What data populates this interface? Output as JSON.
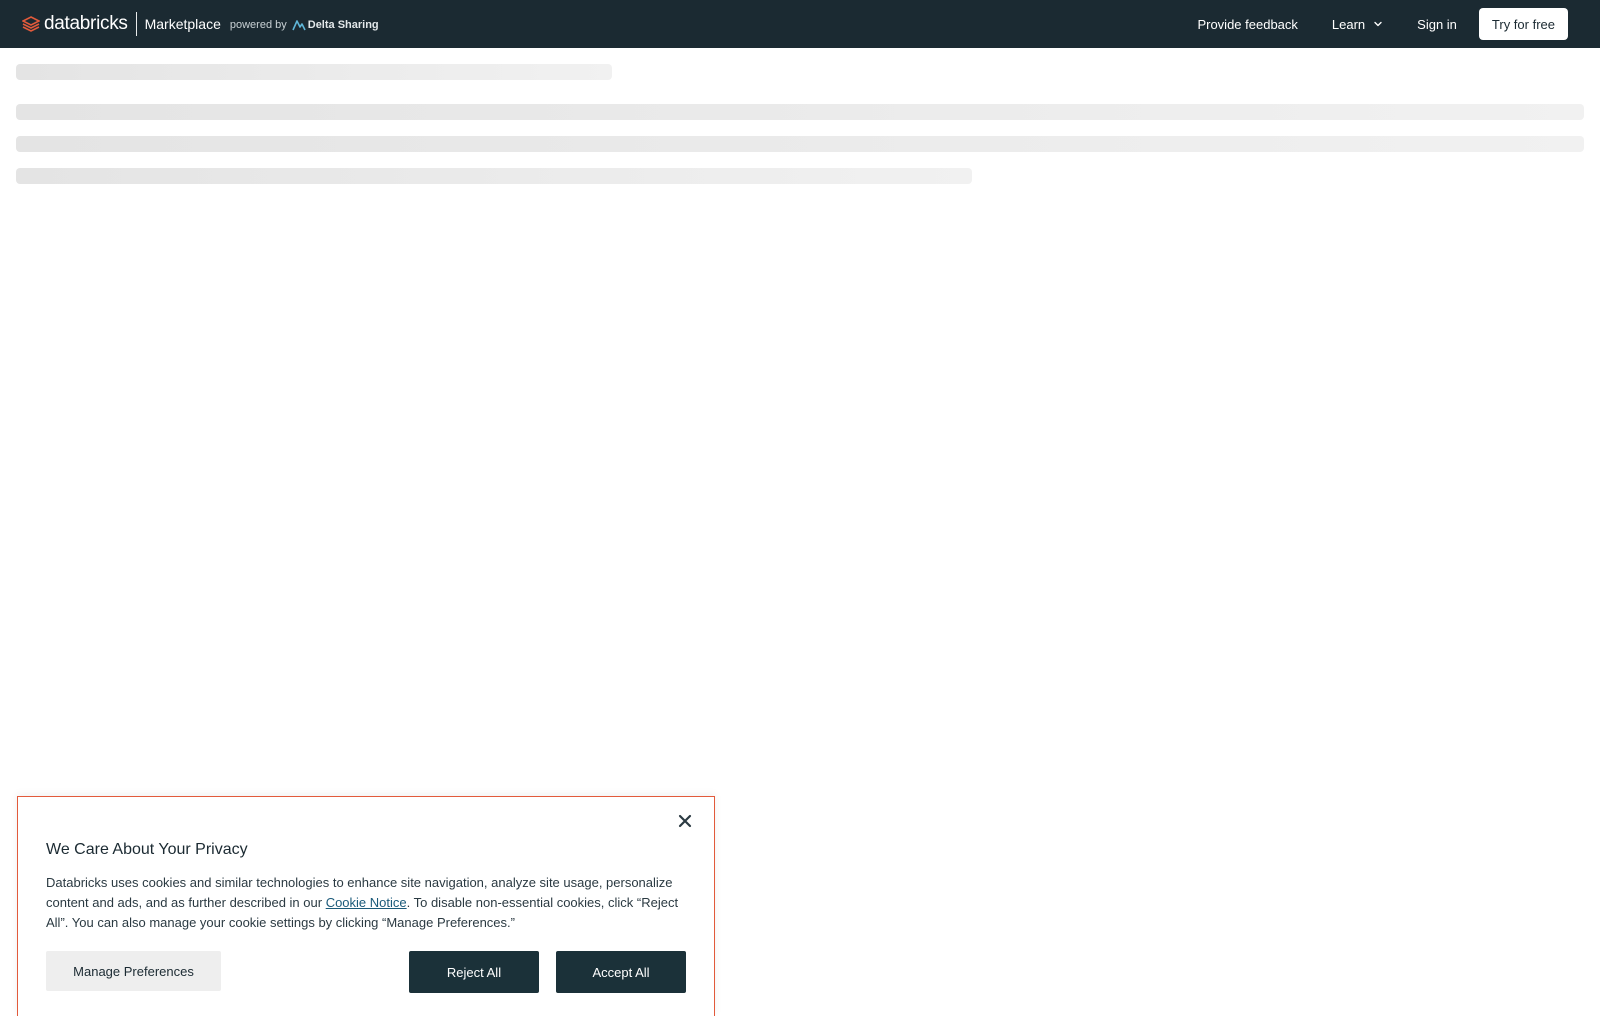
{
  "header": {
    "brand_name": "databricks",
    "product_name": "Marketplace",
    "powered_by_label": "powered by",
    "powered_by_product": "Delta Sharing",
    "nav": {
      "feedback_label": "Provide feedback",
      "learn_label": "Learn",
      "signin_label": "Sign in",
      "try_label": "Try for free"
    }
  },
  "cookie_banner": {
    "title": "We Care About Your Privacy",
    "body_before_link": "Databricks uses cookies and similar technologies to enhance site navigation, analyze site usage, personalize content and ads, and as further described in our ",
    "link_text": "Cookie Notice",
    "body_after_link": ". To disable non-essential cookies, click “Reject All”. You can also manage your cookie settings by clicking “Manage Preferences.”",
    "manage_label": "Manage Preferences",
    "reject_label": "Reject All",
    "accept_label": "Accept All"
  },
  "icons": {
    "logo": "databricks-logo-icon",
    "delta": "delta-sharing-icon",
    "learn_chevron": "chevron-down-icon",
    "close": "close-icon"
  },
  "colors": {
    "header_bg": "#1b2a32",
    "logo_accent": "#e25a3b",
    "primary_button": "#1b3139",
    "modal_border": "#e25a3b"
  }
}
